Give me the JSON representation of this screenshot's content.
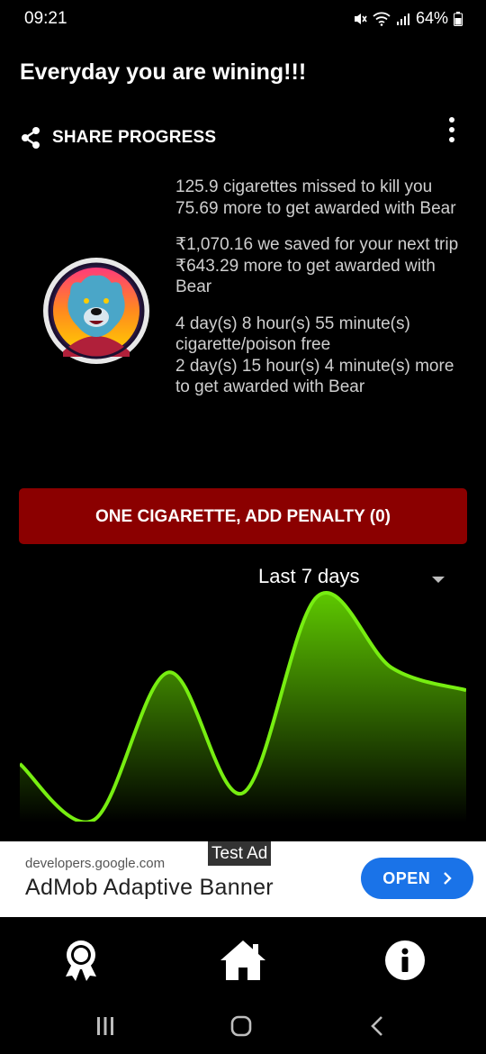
{
  "status": {
    "time": "09:21",
    "battery": "64%"
  },
  "headline": "Everyday you are wining!!!",
  "share": {
    "label": "SHARE PROGRESS",
    "icon": "share-icon"
  },
  "stats": {
    "cigarettes": {
      "line1": "125.9 cigarettes missed to kill you",
      "line2": "75.69 more to get awarded with Bear"
    },
    "money": {
      "line1": "₹1,070.16 we saved for your next trip",
      "line2": "₹643.29 more to get awarded with Bear"
    },
    "time": {
      "line1": "4 day(s) 8 hour(s) 55 minute(s) cigarette/poison free",
      "line2": "2 day(s) 15 hour(s) 4 minute(s) more to get awarded with Bear"
    }
  },
  "penalty_button": {
    "label": "ONE CIGARETTE, ADD PENALTY (0)"
  },
  "range": {
    "selected": "Last 7 days"
  },
  "chart_data": {
    "type": "area",
    "x": [
      0,
      1,
      2,
      3,
      4,
      5,
      6
    ],
    "values": [
      0.25,
      0.0,
      0.66,
      0.12,
      1.0,
      0.68,
      0.58
    ],
    "ylim": [
      0,
      1
    ],
    "xlabel": "",
    "ylabel": "",
    "line_color": "#77ee11",
    "fill_top": "#5ec800",
    "fill_bottom": "#000000"
  },
  "ad": {
    "tag": "Test Ad",
    "url": "developers.google.com",
    "title": "AdMob Adaptive Banner",
    "button": "OPEN"
  },
  "bottom_nav": {
    "items": [
      {
        "icon": "award-icon"
      },
      {
        "icon": "home-icon"
      },
      {
        "icon": "info-icon"
      }
    ]
  },
  "system_nav": {
    "icons": [
      "recents-icon",
      "home-circle-icon",
      "back-icon"
    ]
  }
}
